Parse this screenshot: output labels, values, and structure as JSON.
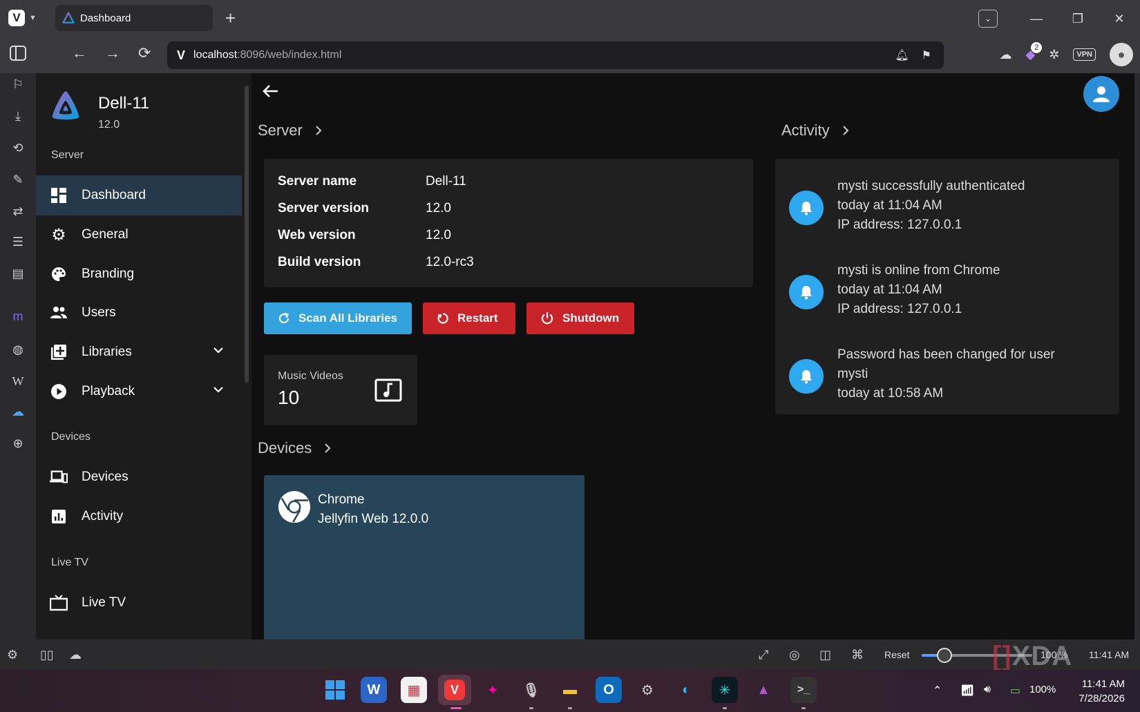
{
  "browser": {
    "tab_title": "Dashboard",
    "url_host": "localhost",
    "url_rest": ":8096/web/index.html",
    "extension_badge": "2",
    "vpn_label": "VPN"
  },
  "drawer": {
    "server_name": "Dell-11",
    "server_version": "12.0",
    "section_server": "Server",
    "items_server": [
      {
        "label": "Dashboard"
      },
      {
        "label": "General"
      },
      {
        "label": "Branding"
      },
      {
        "label": "Users"
      },
      {
        "label": "Libraries"
      },
      {
        "label": "Playback"
      }
    ],
    "section_devices": "Devices",
    "items_devices": [
      {
        "label": "Devices"
      },
      {
        "label": "Activity"
      }
    ],
    "section_livetv": "Live TV",
    "items_livetv": [
      {
        "label": "Live TV"
      }
    ]
  },
  "main": {
    "server_section_title": "Server",
    "server_info": [
      {
        "label": "Server name",
        "value": "Dell-11"
      },
      {
        "label": "Server version",
        "value": "12.0"
      },
      {
        "label": "Web version",
        "value": "12.0"
      },
      {
        "label": "Build version",
        "value": "12.0-rc3"
      }
    ],
    "buttons": {
      "scan": "Scan All Libraries",
      "restart": "Restart",
      "shutdown": "Shutdown"
    },
    "library_card": {
      "name": "Music Videos",
      "count": "10"
    },
    "devices_section_title": "Devices",
    "device": {
      "name": "Chrome",
      "app": "Jellyfin Web 12.0.0"
    },
    "activity_section_title": "Activity",
    "activity": [
      {
        "line1": "mysti successfully authenticated",
        "line2": "today at 11:04 AM",
        "line3": "IP address: 127.0.0.1"
      },
      {
        "line1": "mysti is online from Chrome",
        "line2": "today at 11:04 AM",
        "line3": "IP address: 127.0.0.1"
      },
      {
        "line1": "Password has been changed for user",
        "line2": "mysti",
        "line3": "today at 10:58 AM"
      }
    ]
  },
  "statusbar": {
    "reset_label": "Reset",
    "zoom": "100 %",
    "time": "11:41 AM",
    "watermark": "XDA"
  },
  "taskbar": {
    "battery": "100%",
    "time": "11:41 AM",
    "date": "7/28/2026"
  },
  "colors": {
    "accent_active": "#26394a",
    "scan_button": "#33a3dd",
    "danger_button": "#c8242a",
    "bell": "#2ea9f0",
    "device_card": "#264558"
  }
}
